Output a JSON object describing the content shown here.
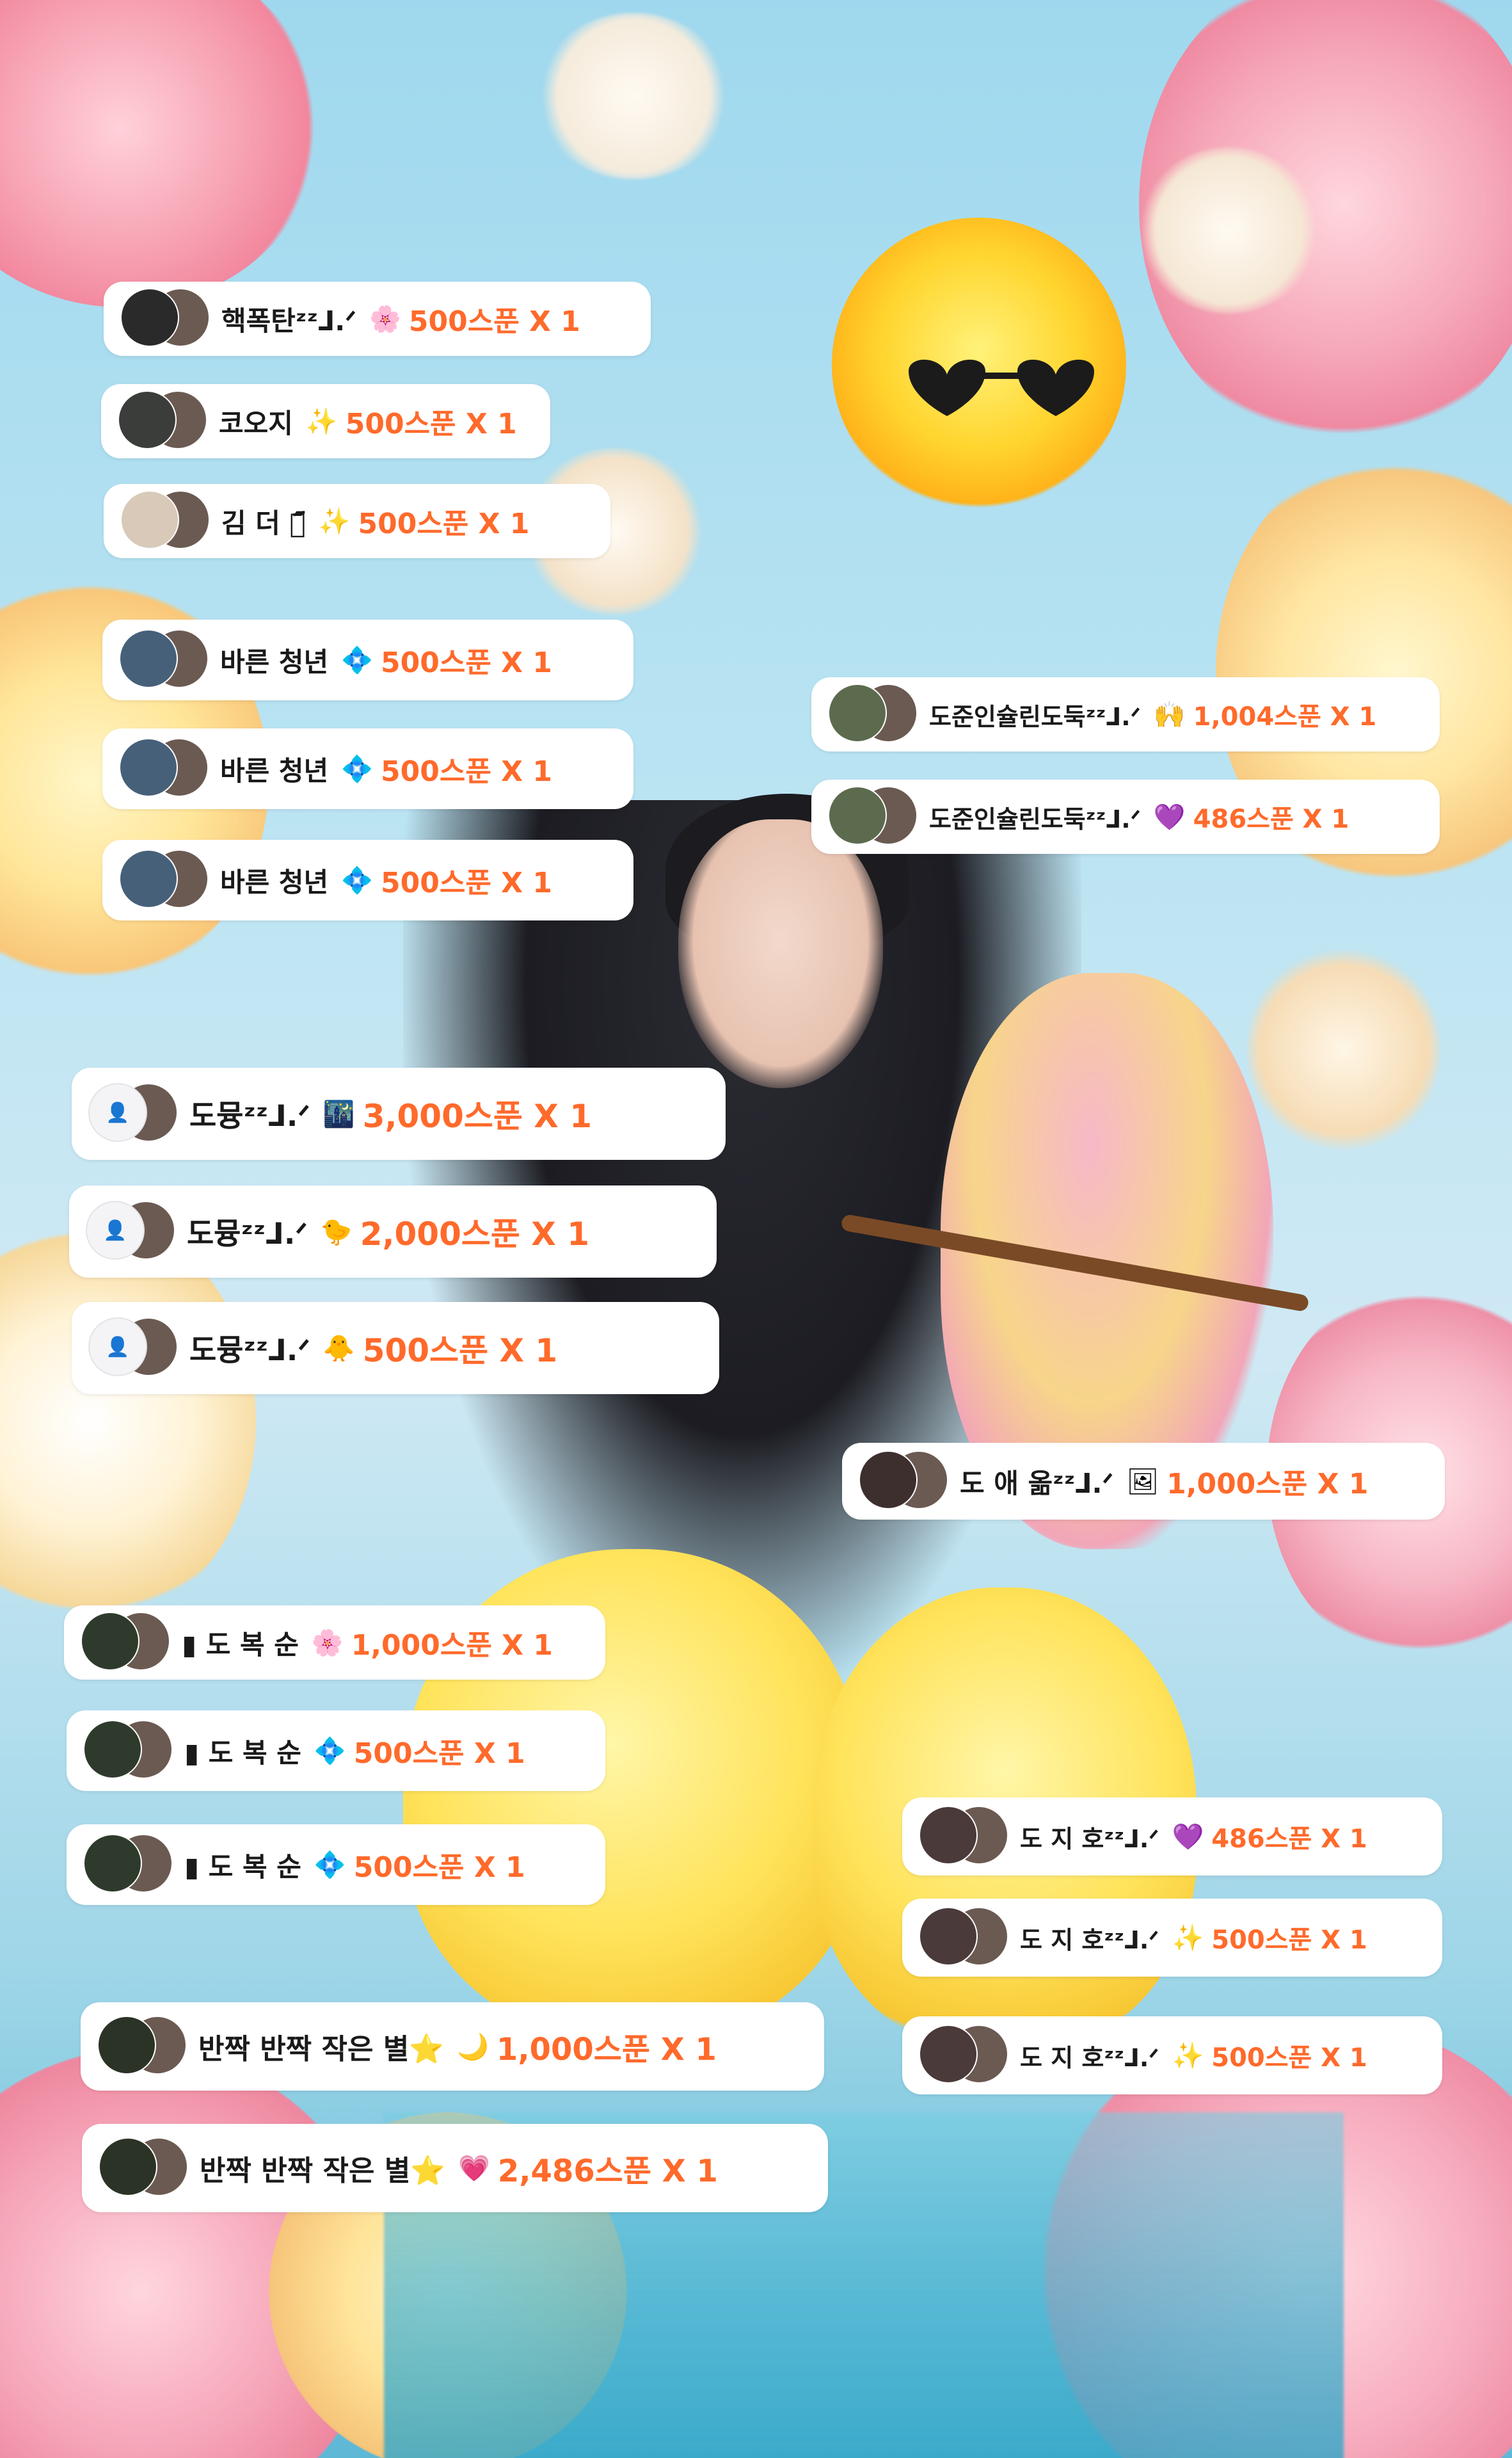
{
  "colors": {
    "amount": "#ff6a2b",
    "name": "#1a1a1a",
    "bubble": "#ffffff"
  },
  "messages": [
    {
      "name": "핵폭탄ᶻᶻᒧ.ᐟ",
      "gift_icon": "pink-gift-icon",
      "gift_glyph": "🌸",
      "amount": "500스푼 X 1"
    },
    {
      "name": "코오지",
      "gift_icon": "sparkle-gift-icon",
      "gift_glyph": "✨",
      "amount": "500스푼 X 1"
    },
    {
      "name": "김 더 덕᷇᷄",
      "gift_icon": "sparkle-gift-icon",
      "gift_glyph": "✨",
      "amount": "500스푼 X 1"
    },
    {
      "name": "바른 청년",
      "gift_icon": "bubble-gift-icon",
      "gift_glyph": "💠",
      "amount": "500스푼 X 1"
    },
    {
      "name": "바른 청년",
      "gift_icon": "bubble-gift-icon",
      "gift_glyph": "💠",
      "amount": "500스푼 X 1"
    },
    {
      "name": "바른 청년",
      "gift_icon": "bubble-gift-icon",
      "gift_glyph": "💠",
      "amount": "500스푼 X 1"
    },
    {
      "name": "도준인슐린도둑ᶻᶻᒧ.ᐟ",
      "gift_icon": "hands-gift-icon",
      "gift_glyph": "🙌",
      "amount": "1,004스푼 X 1"
    },
    {
      "name": "도준인슐린도둑ᶻᶻᒧ.ᐟ",
      "gift_icon": "heart-gift-icon",
      "gift_glyph": "💜",
      "amount": "486스푼 X 1"
    },
    {
      "name": "도뮹ᶻᶻᒧ.ᐟ",
      "gift_icon": "photo-gift-icon",
      "gift_glyph": "🌃",
      "amount": "3,000스푼 X 1"
    },
    {
      "name": "도뮹ᶻᶻᒧ.ᐟ",
      "gift_icon": "chick-gift-icon",
      "gift_glyph": "🐤",
      "amount": "2,000스푼 X 1"
    },
    {
      "name": "도뮹ᶻᶻᒧ.ᐟ",
      "gift_icon": "chick-gift-icon",
      "gift_glyph": "🐥",
      "amount": "500스푼 X 1"
    },
    {
      "name": "도 애 옮ᶻᶻᒧ.ᐟ",
      "gift_icon": "frame-gift-icon",
      "gift_glyph": "🖼",
      "amount": "1,000스푼 X 1"
    },
    {
      "name": "▮ 도 복 순",
      "gift_icon": "pink-gift-icon",
      "gift_glyph": "🌸",
      "amount": "1,000스푼 X 1"
    },
    {
      "name": "▮ 도 복 순",
      "gift_icon": "bubble-gift-icon",
      "gift_glyph": "💠",
      "amount": "500스푼 X 1"
    },
    {
      "name": "▮ 도 복 순",
      "gift_icon": "bubble-gift-icon",
      "gift_glyph": "💠",
      "amount": "500스푼 X 1"
    },
    {
      "name": "도 지 호ᶻᶻᒧ.ᐟ",
      "gift_icon": "heart-gift-icon",
      "gift_glyph": "💜",
      "amount": "486스푼 X 1"
    },
    {
      "name": "도 지 호ᶻᶻᒧ.ᐟ",
      "gift_icon": "sparkle-gift-icon",
      "gift_glyph": "✨",
      "amount": "500스푼 X 1"
    },
    {
      "name": "도 지 호ᶻᶻᒧ.ᐟ",
      "gift_icon": "sparkle-gift-icon",
      "gift_glyph": "✨",
      "amount": "500스푼 X 1"
    },
    {
      "name": "반짝 반짝 작은 별⭐",
      "gift_icon": "moon-gift-icon",
      "gift_glyph": "🌙",
      "amount": "1,000스푼 X 1"
    },
    {
      "name": "반짝 반짝 작은 별⭐",
      "gift_icon": "potion-gift-icon",
      "gift_glyph": "💗",
      "amount": "2,486스푼 X 1"
    }
  ]
}
